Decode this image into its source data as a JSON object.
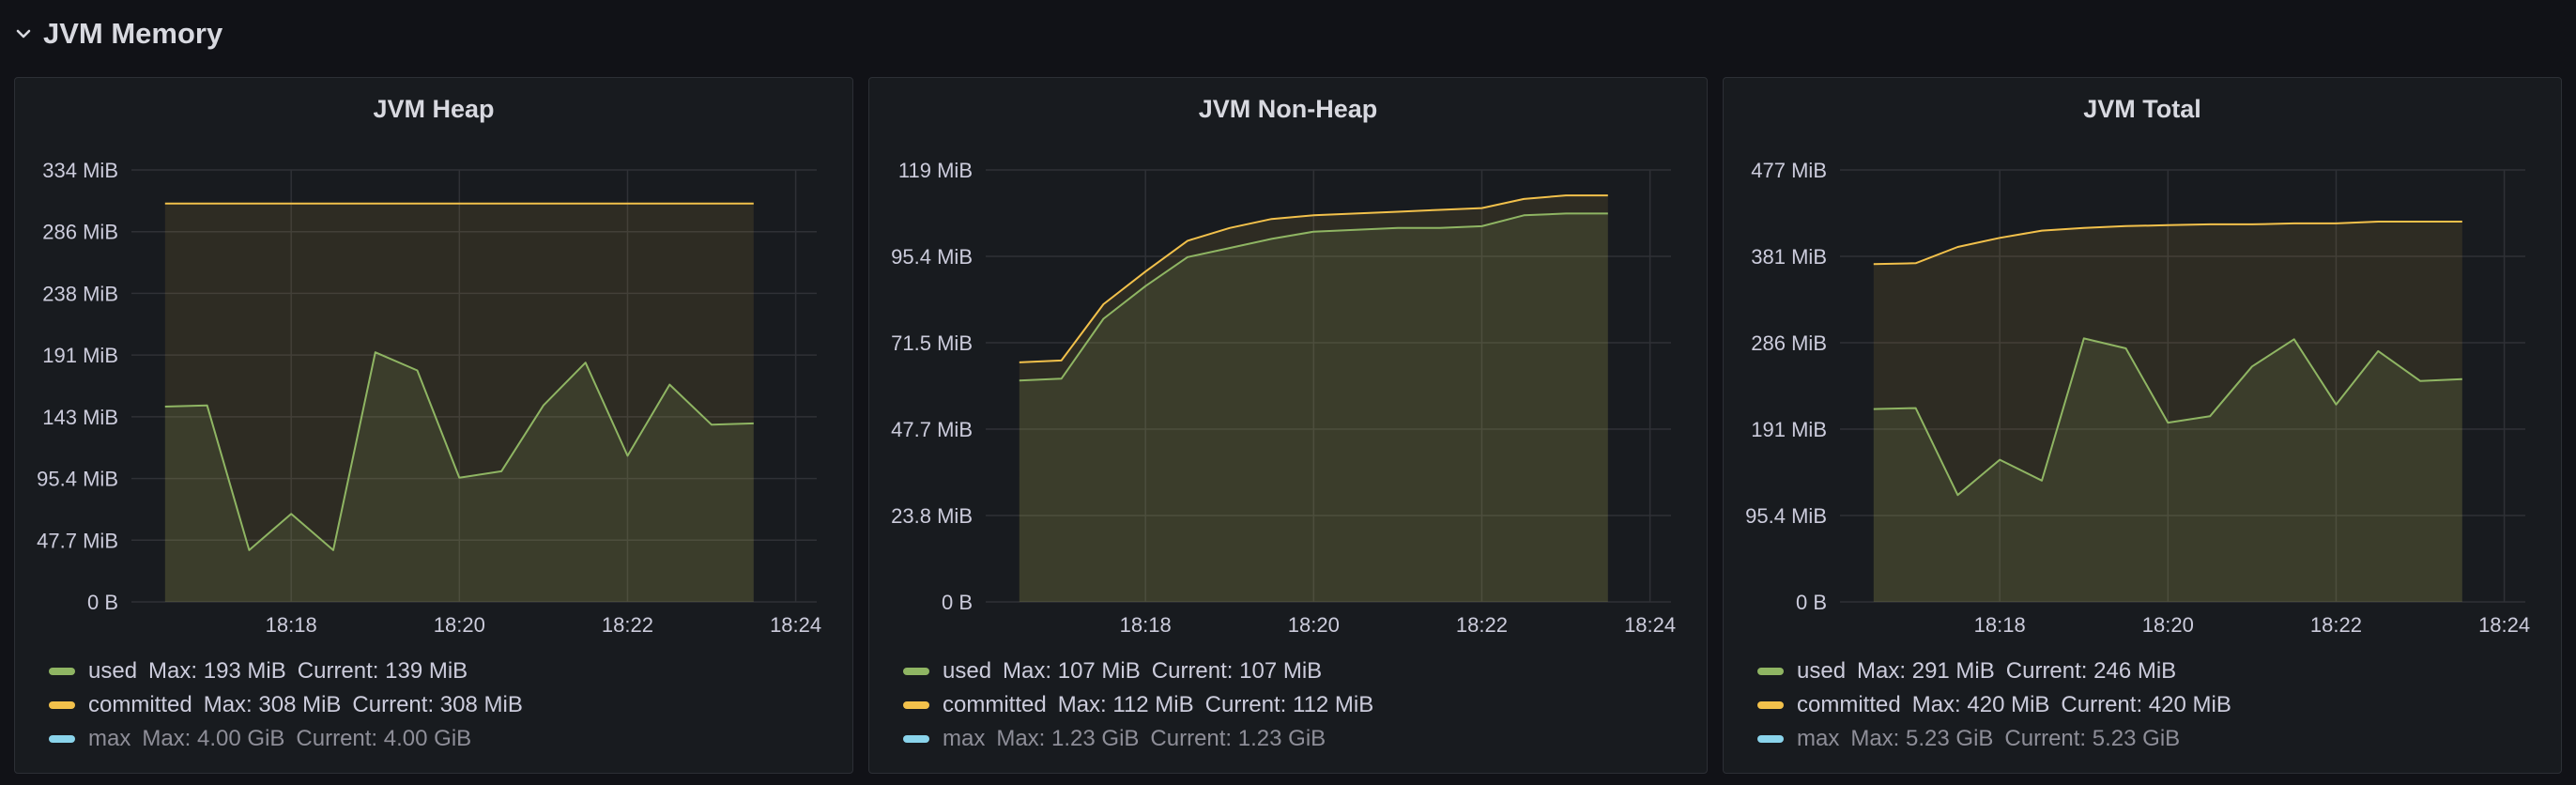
{
  "row": {
    "title": "JVM Memory"
  },
  "colors": {
    "used": "#8fb563",
    "committed": "#f2c14b",
    "max": "#8ad4eb"
  },
  "legend_labels": {
    "max": "Max:",
    "current": "Current:"
  },
  "panels": [
    {
      "title": "JVM Heap",
      "chart_data": {
        "type": "area",
        "x": [
          "18:16:30",
          "18:17:00",
          "18:17:30",
          "18:18:00",
          "18:18:30",
          "18:19:00",
          "18:19:30",
          "18:20:00",
          "18:20:30",
          "18:21:00",
          "18:21:30",
          "18:22:00",
          "18:22:30",
          "18:23:00",
          "18:23:30"
        ],
        "x_ticks": [
          "18:18",
          "18:20",
          "18:22",
          "18:24"
        ],
        "y_ticks": [
          "0 B",
          "47.7 MiB",
          "95.4 MiB",
          "143 MiB",
          "191 MiB",
          "238 MiB",
          "286 MiB",
          "334 MiB"
        ],
        "ylim": [
          0,
          334
        ],
        "series": [
          {
            "name": "used",
            "values": [
              151,
              152,
              40,
              68,
              40,
              193,
              179,
              96,
              101,
              152,
              185,
              113,
              168,
              137,
              138
            ]
          },
          {
            "name": "committed",
            "values": [
              308,
              308,
              308,
              308,
              308,
              308,
              308,
              308,
              308,
              308,
              308,
              308,
              308,
              308,
              308
            ]
          }
        ]
      },
      "legend": [
        {
          "name": "used",
          "max": "193 MiB",
          "current": "139 MiB"
        },
        {
          "name": "committed",
          "max": "308 MiB",
          "current": "308 MiB"
        },
        {
          "name": "max",
          "max": "4.00 GiB",
          "current": "4.00 GiB"
        }
      ]
    },
    {
      "title": "JVM Non-Heap",
      "chart_data": {
        "type": "area",
        "x": [
          "18:16:30",
          "18:17:00",
          "18:17:30",
          "18:18:00",
          "18:18:30",
          "18:19:00",
          "18:19:30",
          "18:20:00",
          "18:20:30",
          "18:21:00",
          "18:21:30",
          "18:22:00",
          "18:22:30",
          "18:23:00",
          "18:23:30"
        ],
        "x_ticks": [
          "18:18",
          "18:20",
          "18:22",
          "18:24"
        ],
        "y_ticks": [
          "0 B",
          "23.8 MiB",
          "47.7 MiB",
          "71.5 MiB",
          "95.4 MiB",
          "119 MiB"
        ],
        "ylim": [
          0,
          119
        ],
        "series": [
          {
            "name": "used",
            "values": [
              61,
              61.5,
              78,
              87,
              95,
              97.5,
              100,
              102,
              102.5,
              103,
              103,
              103.5,
              106.5,
              107,
              107
            ]
          },
          {
            "name": "committed",
            "values": [
              66,
              66.5,
              82,
              91,
              99.5,
              103,
              105.5,
              106.5,
              107,
              107.5,
              108,
              108.5,
              111,
              112,
              112
            ]
          }
        ]
      },
      "legend": [
        {
          "name": "used",
          "max": "107 MiB",
          "current": "107 MiB"
        },
        {
          "name": "committed",
          "max": "112 MiB",
          "current": "112 MiB"
        },
        {
          "name": "max",
          "max": "1.23 GiB",
          "current": "1.23 GiB"
        }
      ]
    },
    {
      "title": "JVM Total",
      "chart_data": {
        "type": "area",
        "x": [
          "18:16:30",
          "18:17:00",
          "18:17:30",
          "18:18:00",
          "18:18:30",
          "18:19:00",
          "18:19:30",
          "18:20:00",
          "18:20:30",
          "18:21:00",
          "18:21:30",
          "18:22:00",
          "18:22:30",
          "18:23:00",
          "18:23:30"
        ],
        "x_ticks": [
          "18:18",
          "18:20",
          "18:22",
          "18:24"
        ],
        "y_ticks": [
          "0 B",
          "95.4 MiB",
          "191 MiB",
          "286 MiB",
          "381 MiB",
          "477 MiB"
        ],
        "ylim": [
          0,
          477
        ],
        "series": [
          {
            "name": "used",
            "values": [
              213,
              214,
              118,
              157,
              134,
              291,
              280,
              198,
              205,
              260,
              290,
              218,
              277,
              244,
              246
            ]
          },
          {
            "name": "committed",
            "values": [
              373,
              374,
              392,
              402,
              410,
              413,
              415,
              416,
              417,
              417,
              418,
              418,
              420,
              420,
              420
            ]
          }
        ]
      },
      "legend": [
        {
          "name": "used",
          "max": "291 MiB",
          "current": "246 MiB"
        },
        {
          "name": "committed",
          "max": "420 MiB",
          "current": "420 MiB"
        },
        {
          "name": "max",
          "max": "5.23 GiB",
          "current": "5.23 GiB"
        }
      ]
    }
  ]
}
